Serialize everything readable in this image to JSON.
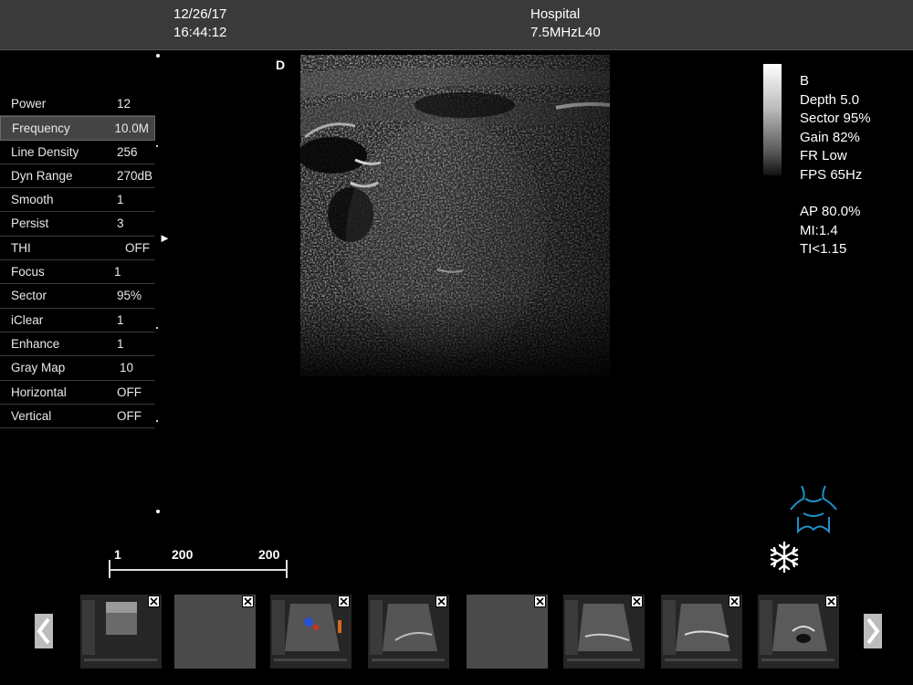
{
  "header": {
    "date": "12/26/17",
    "time": "16:44:12",
    "hospital": "Hospital",
    "probe": "7.5MHzL40"
  },
  "params": [
    {
      "label": "Power",
      "value": "12"
    },
    {
      "label": "Frequency",
      "value": "10.0M"
    },
    {
      "label": "Line Density",
      "value": "256"
    },
    {
      "label": "Dyn Range",
      "value": "270dB"
    },
    {
      "label": "Smooth",
      "value": "1"
    },
    {
      "label": "Persist",
      "value": "3"
    },
    {
      "label": "THI",
      "value": "OFF"
    },
    {
      "label": "Focus",
      "value": "1"
    },
    {
      "label": "Sector",
      "value": "95%"
    },
    {
      "label": "iClear",
      "value": "1"
    },
    {
      "label": "Enhance",
      "value": "1"
    },
    {
      "label": "Gray Map",
      "value": "10"
    },
    {
      "label": "Horizontal",
      "value": "OFF"
    },
    {
      "label": "Vertical",
      "value": "OFF"
    }
  ],
  "selected_param": "Frequency",
  "image_marker": "D",
  "info": {
    "mode": "B",
    "depth": "Depth 5.0",
    "sector": "Sector 95%",
    "gain": "Gain 82%",
    "fr": "FR Low",
    "fps": "FPS 65Hz",
    "ap": "AP 80.0%",
    "mi": "MI:1.4",
    "ti": "TI<1.15"
  },
  "scale": {
    "left": "1",
    "mid": "200",
    "right": "200"
  },
  "icons": {
    "prev": "chevron-left-icon",
    "next": "chevron-right-icon",
    "freeze": "snowflake-icon",
    "body_mark": "neck-body-mark-icon",
    "close": "close-icon"
  },
  "colors": {
    "background": "#000000",
    "header": "#3a3a3a",
    "body_mark": "#1e90c8"
  },
  "thumbnails": [
    {
      "kind": "ultrasound"
    },
    {
      "kind": "empty"
    },
    {
      "kind": "color"
    },
    {
      "kind": "ultrasound"
    },
    {
      "kind": "empty"
    },
    {
      "kind": "ultrasound"
    },
    {
      "kind": "ultrasound"
    },
    {
      "kind": "ultrasound"
    }
  ]
}
